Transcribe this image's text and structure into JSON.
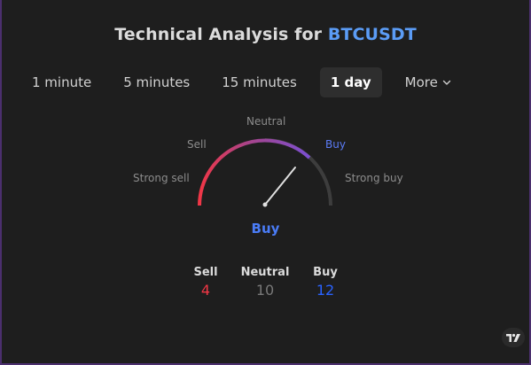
{
  "header": {
    "title_prefix": "Technical Analysis for",
    "symbol": "BTCUSDT"
  },
  "tabs": [
    {
      "label": "1 minute",
      "active": false
    },
    {
      "label": "5 minutes",
      "active": false
    },
    {
      "label": "15 minutes",
      "active": false
    },
    {
      "label": "1 day",
      "active": true
    },
    {
      "label": "More",
      "active": false,
      "icon": "chevron-down-icon"
    }
  ],
  "gauge": {
    "labels": {
      "strong_sell": "Strong sell",
      "sell": "Sell",
      "neutral": "Neutral",
      "buy": "Buy",
      "strong_buy": "Strong buy"
    },
    "active_label": "buy",
    "verdict": "Buy",
    "colors": {
      "sell": "#f23645",
      "neutral_arc": "#7b4fd0",
      "buy_highlight": "#5b7bf6",
      "track": "#3d3d3d",
      "needle": "#e0e0e0"
    }
  },
  "counts": {
    "sell": {
      "label": "Sell",
      "value": "4"
    },
    "neutral": {
      "label": "Neutral",
      "value": "10"
    },
    "buy": {
      "label": "Buy",
      "value": "12"
    }
  },
  "branding": {
    "logo": "tradingview-logo-icon"
  }
}
